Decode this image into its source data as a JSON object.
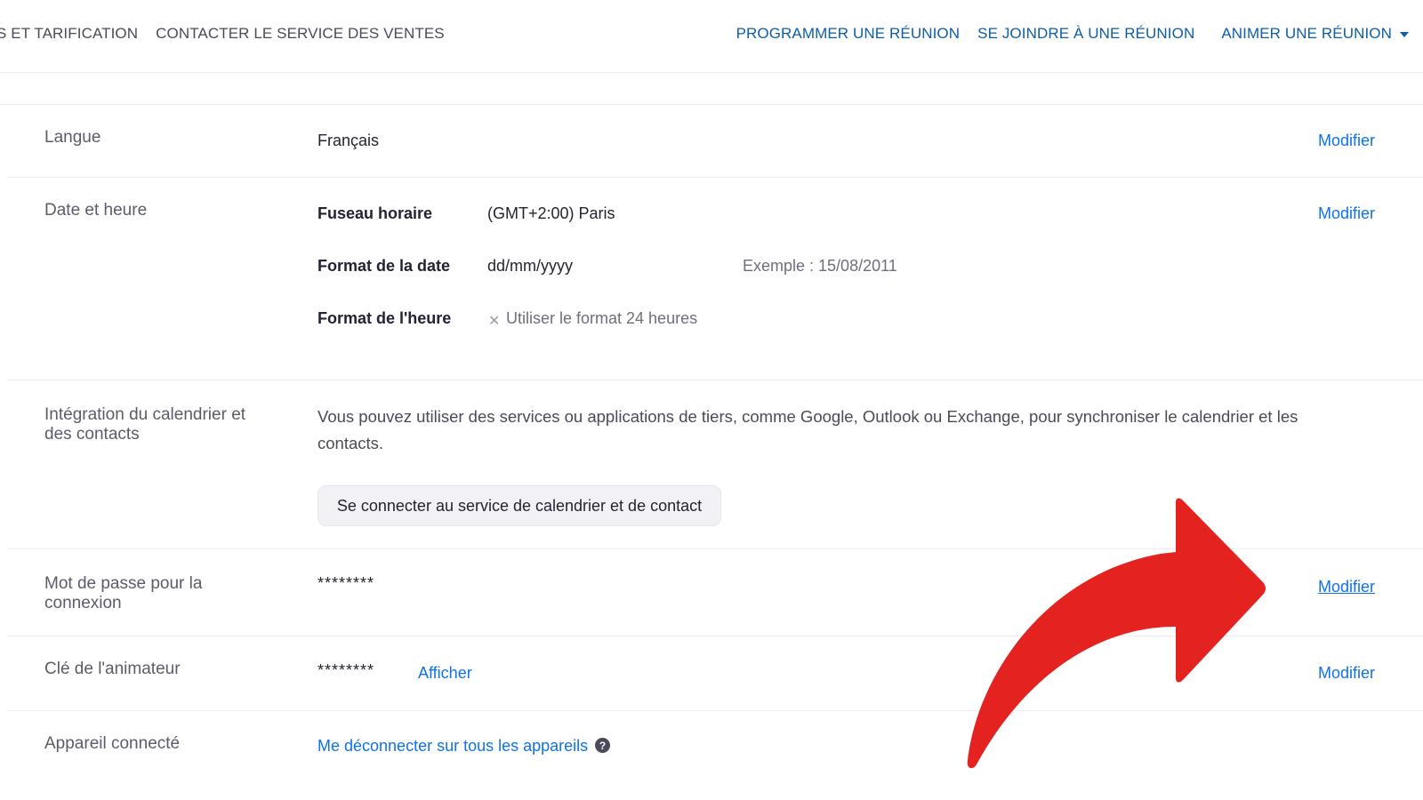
{
  "nav": {
    "left_links": [
      "S ET TARIFICATION",
      "CONTACTER LE SERVICE DES VENTES"
    ],
    "schedule": "PROGRAMMER UNE RÉUNION",
    "join": "SE JOINDRE À UNE RÉUNION",
    "host": "ANIMER UNE RÉUNION"
  },
  "rows": {
    "language": {
      "label": "Langue",
      "value": "Français",
      "action": "Modifier"
    },
    "datetime": {
      "label": "Date et heure",
      "timezone_label": "Fuseau horaire",
      "timezone_value": "(GMT+2:00) Paris",
      "date_format_label": "Format de la date",
      "date_format_value": "dd/mm/yyyy",
      "date_example": "Exemple : 15/08/2011",
      "time_format_label": "Format de l'heure",
      "time_format_value": "Utiliser le format 24 heures",
      "action": "Modifier"
    },
    "calendar": {
      "label": "Intégration du calendrier et des contacts",
      "description": "Vous pouvez utiliser des services ou applications de tiers, comme Google, Outlook ou Exchange, pour synchroniser le calendrier et les contacts.",
      "button": "Se connecter au service de calendrier et de contact"
    },
    "password": {
      "label": "Mot de passe pour la connexion",
      "value": "********",
      "action": "Modifier"
    },
    "host_key": {
      "label": "Clé de l'animateur",
      "value": "********",
      "show": "Afficher",
      "action": "Modifier"
    },
    "device": {
      "label": "Appareil connecté",
      "link": "Me déconnecter sur tous les appareils"
    }
  },
  "colors": {
    "link": "#0e72ed",
    "nav_blue": "#0e5ea8",
    "arrow": "#e42320"
  },
  "icons": {
    "help": "question-circle-icon",
    "close": "x-icon",
    "caret": "caret-down-icon",
    "arrow": "curved-arrow-icon"
  }
}
